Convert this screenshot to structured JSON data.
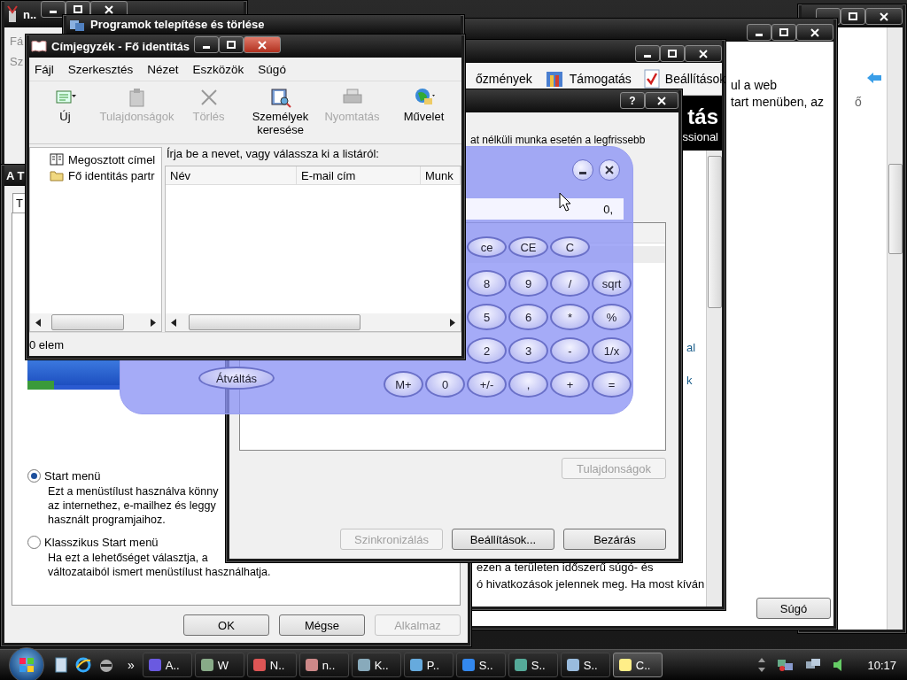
{
  "notepad_window": {
    "title": "n..",
    "menu": [
      "Fá",
      "Sz"
    ]
  },
  "programs_window": {
    "title": "Programok telepítése és törlése"
  },
  "right_window": {
    "text": "ő"
  },
  "back_dialog": {
    "lines": [
      "ul a web",
      "tart menüben, az"
    ],
    "button": "Súgó"
  },
  "help_window": {
    "toolbar": [
      {
        "label": "őzmények"
      },
      {
        "label": "Támogatás"
      },
      {
        "label": "Beállítások"
      }
    ],
    "banner_title": "tás",
    "banner_subtitle": "ssional",
    "link_fragments": [
      "al",
      "k"
    ],
    "footer_lines": [
      "ezen a területen időszerű súgó- és",
      "ó hivatkozások jelennek meg. Ha most kíván"
    ]
  },
  "taskbar_dialog": {
    "title": "A T",
    "tab": "T",
    "options": [
      {
        "label": "Start menü",
        "selected": true,
        "description": [
          "Ezt a menüstílust használva könny",
          "az internethez, e-mailhez és leggy",
          "használt programjaihoz."
        ]
      },
      {
        "label": "Klasszikus Start menü",
        "selected": false,
        "description": [
          "Ha ezt a lehetőséget választja, a",
          "változataiból ismert menüstílust használhatja."
        ]
      }
    ],
    "buttons": [
      {
        "label": "OK",
        "disabled": false
      },
      {
        "label": "Mégse",
        "disabled": false
      },
      {
        "label": "Alkalmaz",
        "disabled": true
      }
    ]
  },
  "sync_dialog": {
    "help_button": "?",
    "intro": "at nélküli munka esetén a legfrissebb",
    "properties_button": {
      "label": "Tulajdonságok",
      "disabled": true
    },
    "buttons": [
      {
        "label": "Szinkronizálás",
        "disabled": true
      },
      {
        "label": "Beállítások...",
        "disabled": false
      },
      {
        "label": "Bezárás",
        "disabled": false
      }
    ]
  },
  "calculator": {
    "display": "0,",
    "switch_button": "Átváltás",
    "key_rows": [
      [
        null,
        null,
        "ce",
        "CE",
        "C",
        null
      ],
      [
        null,
        null,
        "8",
        "9",
        "/",
        "sqrt"
      ],
      [
        null,
        null,
        "5",
        "6",
        "*",
        "%"
      ],
      [
        null,
        null,
        "2",
        "3",
        "-",
        "1/x"
      ],
      [
        "M+",
        "0",
        "+/-",
        ",",
        "+",
        "="
      ]
    ]
  },
  "address_book": {
    "title": "Címjegyzék - Fő identitás",
    "menu": [
      "Fájl",
      "Szerkesztés",
      "Nézet",
      "Eszközök",
      "Súgó"
    ],
    "toolbar": [
      {
        "label": "Új",
        "disabled": false
      },
      {
        "label": "Tulajdonságok",
        "disabled": true
      },
      {
        "label": "Törlés",
        "disabled": true
      },
      {
        "label": "Személyek keresése",
        "disabled": false
      },
      {
        "label": "Nyomtatás",
        "disabled": true
      },
      {
        "label": "Művelet",
        "disabled": false
      }
    ],
    "tree": [
      {
        "label": "Megosztott címel"
      },
      {
        "label": "Fő identitás partr"
      }
    ],
    "search_label": "Írja be a nevet, vagy válassza ki a listáról:",
    "columns": [
      "Név",
      "E-mail cím",
      "Munk"
    ],
    "status": "0 elem"
  },
  "taskbar": {
    "overflow": "»",
    "buttons": [
      {
        "label": "A..",
        "selected": false
      },
      {
        "label": "W",
        "selected": false
      },
      {
        "label": "N..",
        "selected": false
      },
      {
        "label": "n..",
        "selected": false
      },
      {
        "label": "K..",
        "selected": false
      },
      {
        "label": "P..",
        "selected": false
      },
      {
        "label": "S..",
        "selected": false
      },
      {
        "label": "S..",
        "selected": false
      },
      {
        "label": "S..",
        "selected": false
      },
      {
        "label": "C..",
        "selected": true
      }
    ],
    "clock": "10:17"
  }
}
